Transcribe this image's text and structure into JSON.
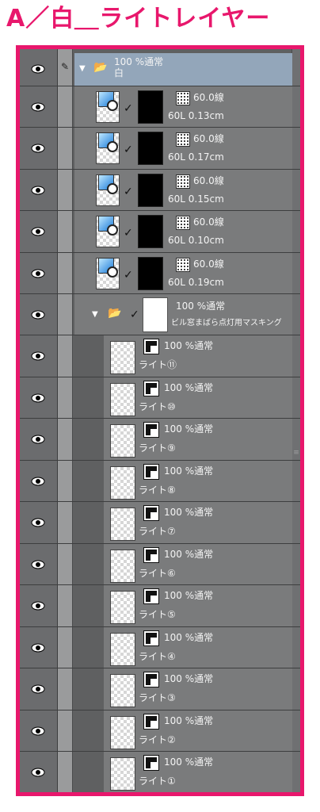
{
  "title": "A／白＿ライトレイヤー",
  "top_group": {
    "opacity_mode": "100 %通常",
    "name": "白"
  },
  "tone_layers": [
    {
      "tone": "60.0線",
      "detail": "60L 0.13cm"
    },
    {
      "tone": "60.0線",
      "detail": "60L 0.17cm"
    },
    {
      "tone": "60.0線",
      "detail": "60L 0.15cm"
    },
    {
      "tone": "60.0線",
      "detail": "60L 0.10cm"
    },
    {
      "tone": "60.0線",
      "detail": "60L 0.19cm"
    }
  ],
  "sub_group": {
    "opacity_mode": "100 %通常",
    "name": "ビル窓まばら点灯用マスキング"
  },
  "light_layers": [
    {
      "mode": "100 %通常",
      "name": "ライト⑪"
    },
    {
      "mode": "100 %通常",
      "name": "ライト⑩"
    },
    {
      "mode": "100 %通常",
      "name": "ライト⑨"
    },
    {
      "mode": "100 %通常",
      "name": "ライト⑧"
    },
    {
      "mode": "100 %通常",
      "name": "ライト⑦"
    },
    {
      "mode": "100 %通常",
      "name": "ライト⑥"
    },
    {
      "mode": "100 %通常",
      "name": "ライト⑤"
    },
    {
      "mode": "100 %通常",
      "name": "ライト④"
    },
    {
      "mode": "100 %通常",
      "name": "ライト③"
    },
    {
      "mode": "100 %通常",
      "name": "ライト②"
    },
    {
      "mode": "100 %通常",
      "name": "ライト①"
    }
  ],
  "colors": {
    "accent": "#e8176c",
    "panel": "#5f6061",
    "group_highlight": "#93a6ba"
  },
  "icons": [
    "eye-icon",
    "brush-icon",
    "folder-icon",
    "tone-icon",
    "checkmark-icon",
    "vector-layer-icon"
  ]
}
